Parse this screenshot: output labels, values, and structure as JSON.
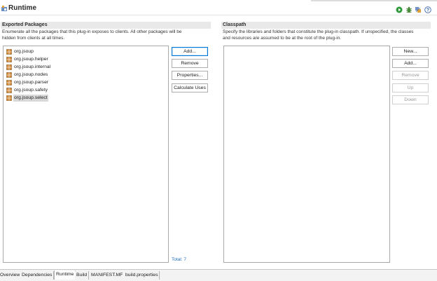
{
  "header": {
    "title": "Runtime",
    "icons": [
      "runtime-plugin-icon",
      "run-icon",
      "debug-icon",
      "export-wizard-icon",
      "help-icon"
    ]
  },
  "exported_packages": {
    "heading": "Exported Packages",
    "description_line1": "Enumerate all the packages that this plug-in exposes to clients.  All other packages will be",
    "description_line2": "hidden from clients at all times.",
    "items": [
      {
        "label": "org.jsoup",
        "selected": false
      },
      {
        "label": "org.jsoup.helper",
        "selected": false
      },
      {
        "label": "org.jsoup.internal",
        "selected": false
      },
      {
        "label": "org.jsoup.nodes",
        "selected": false
      },
      {
        "label": "org.jsoup.parser",
        "selected": false
      },
      {
        "label": "org.jsoup.safety",
        "selected": false
      },
      {
        "label": "org.jsoup.select",
        "selected": true
      }
    ],
    "buttons": {
      "add": "Add...",
      "remove": "Remove",
      "properties": "Properties...",
      "calculate_uses": "Calculate Uses"
    },
    "total": "Total: 7"
  },
  "classpath": {
    "heading": "Classpath",
    "description_line1": "Specify the libraries and folders that constitute the plug-in classpath.  If unspecified, the classes",
    "description_line2": "and resources are assumed to be at the root of the plug-in.",
    "buttons": {
      "new": "New...",
      "add": "Add...",
      "remove": "Remove",
      "up": "Up",
      "down": "Down"
    }
  },
  "tabs": [
    {
      "label": "Overview",
      "active": false
    },
    {
      "label": "Dependencies",
      "active": false
    },
    {
      "label": "Runtime",
      "active": true
    },
    {
      "label": "Build",
      "active": false
    },
    {
      "label": "MANIFEST.MF",
      "active": false
    },
    {
      "label": "build.properties",
      "active": false
    }
  ],
  "colors": {
    "link": "#1f6fbf",
    "section_header_bg": "#e9e9e9",
    "focus_border": "#0078d7",
    "package_icon": "#c8742a"
  }
}
